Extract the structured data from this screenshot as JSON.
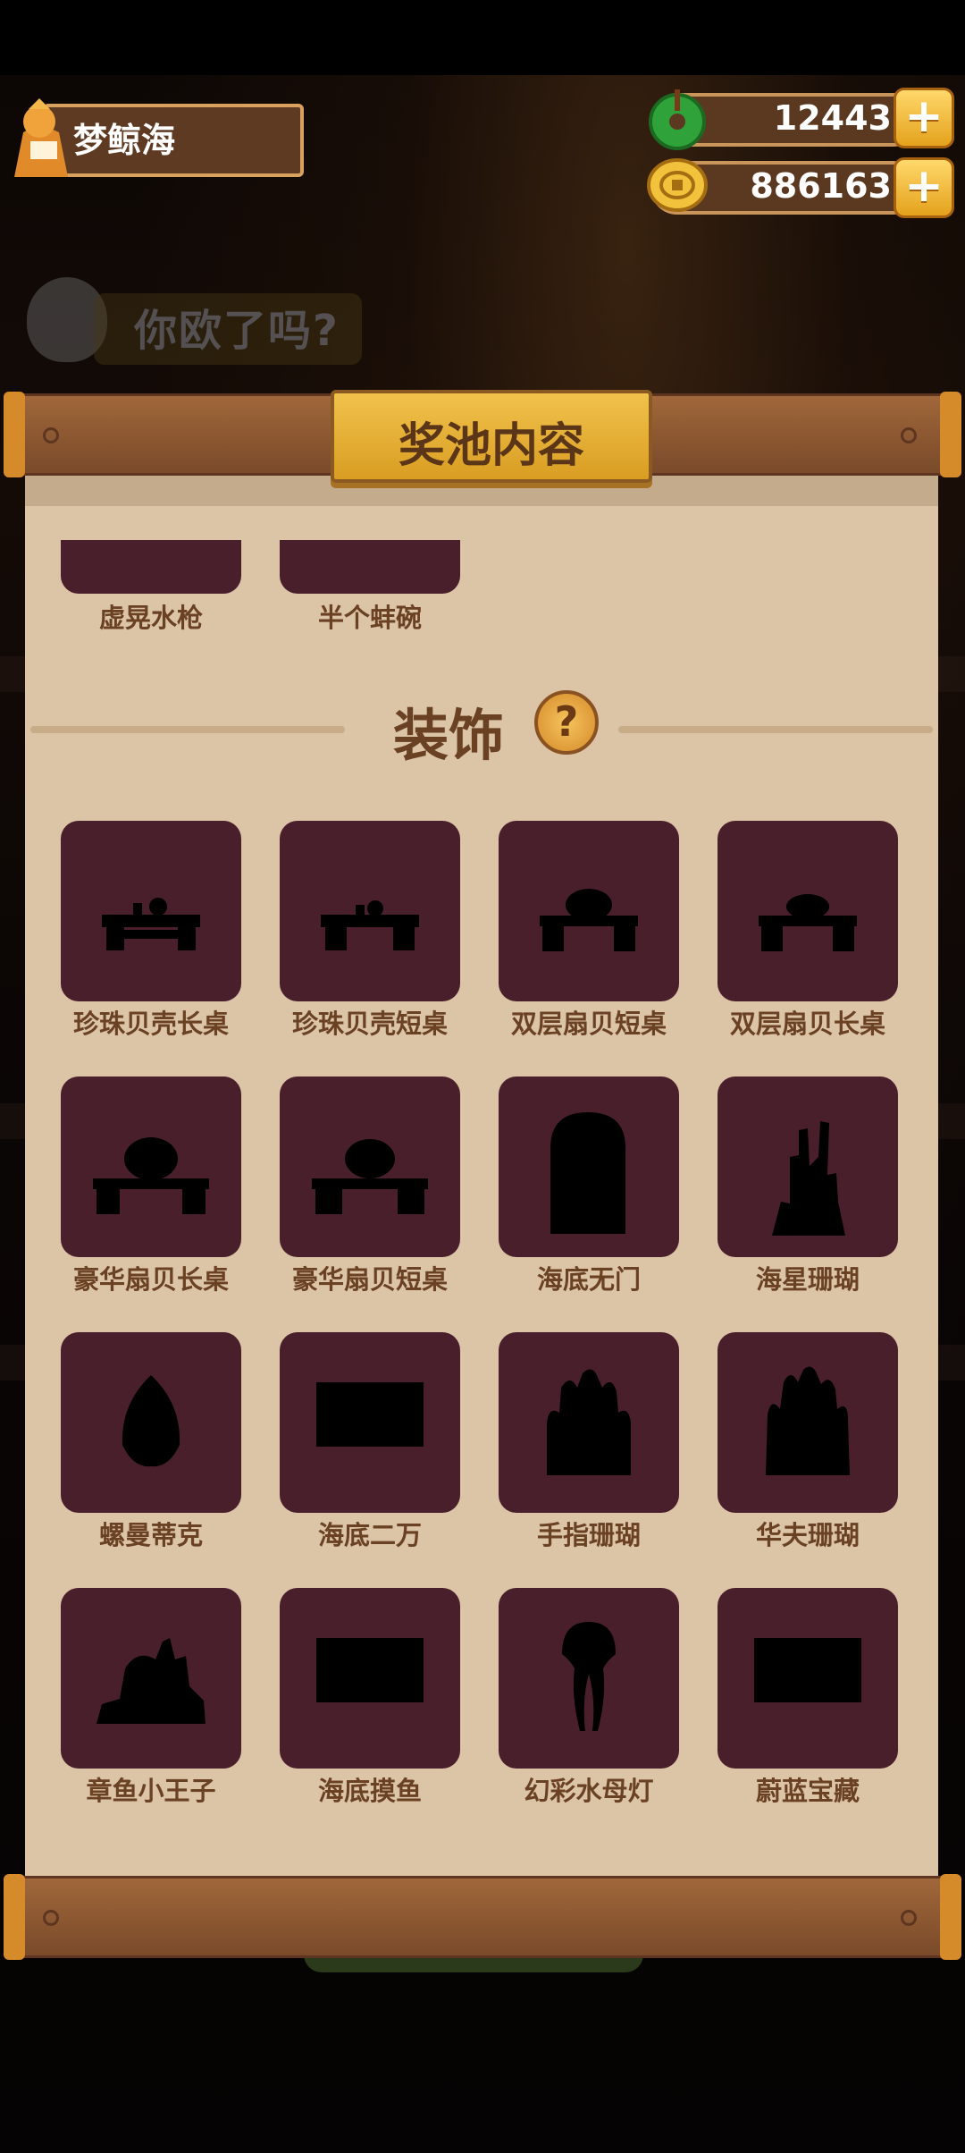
{
  "player": {
    "name": "梦鲸海"
  },
  "currency": {
    "jade": "12443",
    "gold": "886163",
    "plus": "+"
  },
  "background": {
    "banner_text": "你欧了吗?"
  },
  "panel": {
    "title": "奖池内容"
  },
  "prev_section": {
    "items": [
      {
        "label": "虚晃水枪"
      },
      {
        "label": "半个蚌碗"
      }
    ]
  },
  "decor_section": {
    "title": "装饰",
    "help": "?",
    "items": [
      {
        "label": "珍珠贝壳长桌",
        "icon": "table-silhouette"
      },
      {
        "label": "珍珠贝壳短桌",
        "icon": "table-silhouette"
      },
      {
        "label": "双层扇贝短桌",
        "icon": "table-silhouette"
      },
      {
        "label": "双层扇贝长桌",
        "icon": "table-silhouette"
      },
      {
        "label": "豪华扇贝长桌",
        "icon": "table-silhouette"
      },
      {
        "label": "豪华扇贝短桌",
        "icon": "table-silhouette"
      },
      {
        "label": "海底无门",
        "icon": "gate-silhouette"
      },
      {
        "label": "海星珊瑚",
        "icon": "coral-silhouette"
      },
      {
        "label": "螺曼蒂克",
        "icon": "shell-silhouette"
      },
      {
        "label": "海底二万",
        "icon": "rect-silhouette"
      },
      {
        "label": "手指珊瑚",
        "icon": "finger-coral-silhouette"
      },
      {
        "label": "华夫珊瑚",
        "icon": "finger-coral-silhouette"
      },
      {
        "label": "章鱼小王子",
        "icon": "octopus-silhouette"
      },
      {
        "label": "海底摸鱼",
        "icon": "rect-silhouette"
      },
      {
        "label": "幻彩水母灯",
        "icon": "jellyfish-silhouette"
      },
      {
        "label": "蔚蓝宝藏",
        "icon": "rect-silhouette"
      }
    ]
  },
  "colors": {
    "tile": "#4a1f2c",
    "paper": "#dcc4a6",
    "label": "#6b4124",
    "wood": "#8a5530",
    "gold": "#e8b338"
  }
}
